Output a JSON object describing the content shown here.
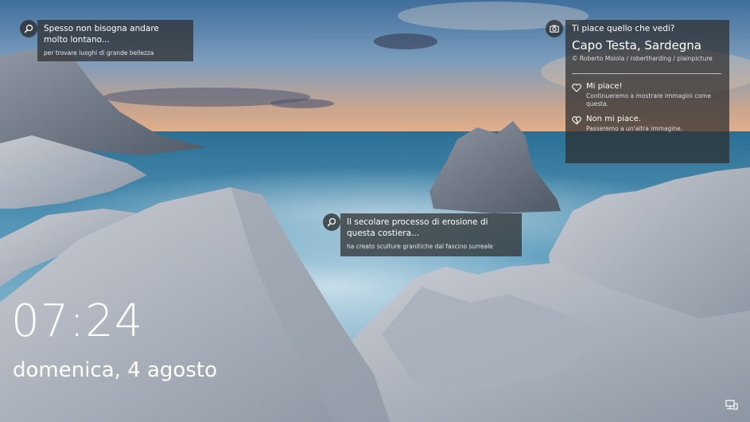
{
  "hotspot1": {
    "title": "Spesso non bisogna andare molto lontano...",
    "subtitle": "per trovare luoghi di grande bellezza",
    "icon": "search-icon"
  },
  "hotspot2": {
    "title": "Il secolare processo di erosione di questa costiera...",
    "subtitle": "ha creato sculture granitiche dal fascino surreale",
    "icon": "search-icon"
  },
  "feedback_panel": {
    "icon": "camera-icon",
    "question": "Ti piace quello che vedi?",
    "place": "Capo Testa, Sardegna",
    "credit": "© Roberto Moiola / robertharding / plainpicture",
    "like": {
      "title": "Mi piace!",
      "subtitle": "Continueremo a mostrare immagini come questa.",
      "icon": "heart-icon"
    },
    "dislike": {
      "title": "Non mi piace.",
      "subtitle": "Passeremo a un'altra immagine.",
      "icon": "broken-heart-icon"
    }
  },
  "lockscreen": {
    "time": "07:24",
    "date": "domenica, 4 agosto",
    "network_icon": "network-icon"
  }
}
